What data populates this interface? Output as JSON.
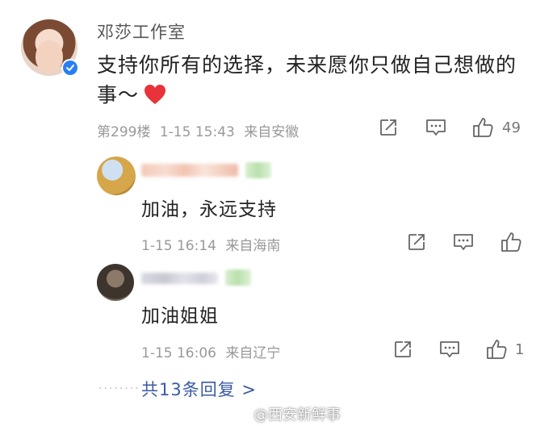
{
  "comment": {
    "author": "邓莎工作室",
    "text": "支持你所有的选择，未来愿你只做自己想做的事～",
    "floor": "第299楼",
    "time": "1-15 15:43",
    "location": "来自安徽",
    "likes": "49"
  },
  "replies": [
    {
      "text": "加油，永远支持",
      "time": "1-15 16:14",
      "location": "来自海南",
      "likes": ""
    },
    {
      "text": "加油姐姐",
      "time": "1-15 16:06",
      "location": "来自辽宁",
      "likes": "1"
    }
  ],
  "more_replies": "共13条回复 >",
  "watermark": "@西安新鲜事",
  "colors": {
    "heart": "#e8333a",
    "link": "#3b5ba3",
    "verified": "#2a7ef5"
  }
}
